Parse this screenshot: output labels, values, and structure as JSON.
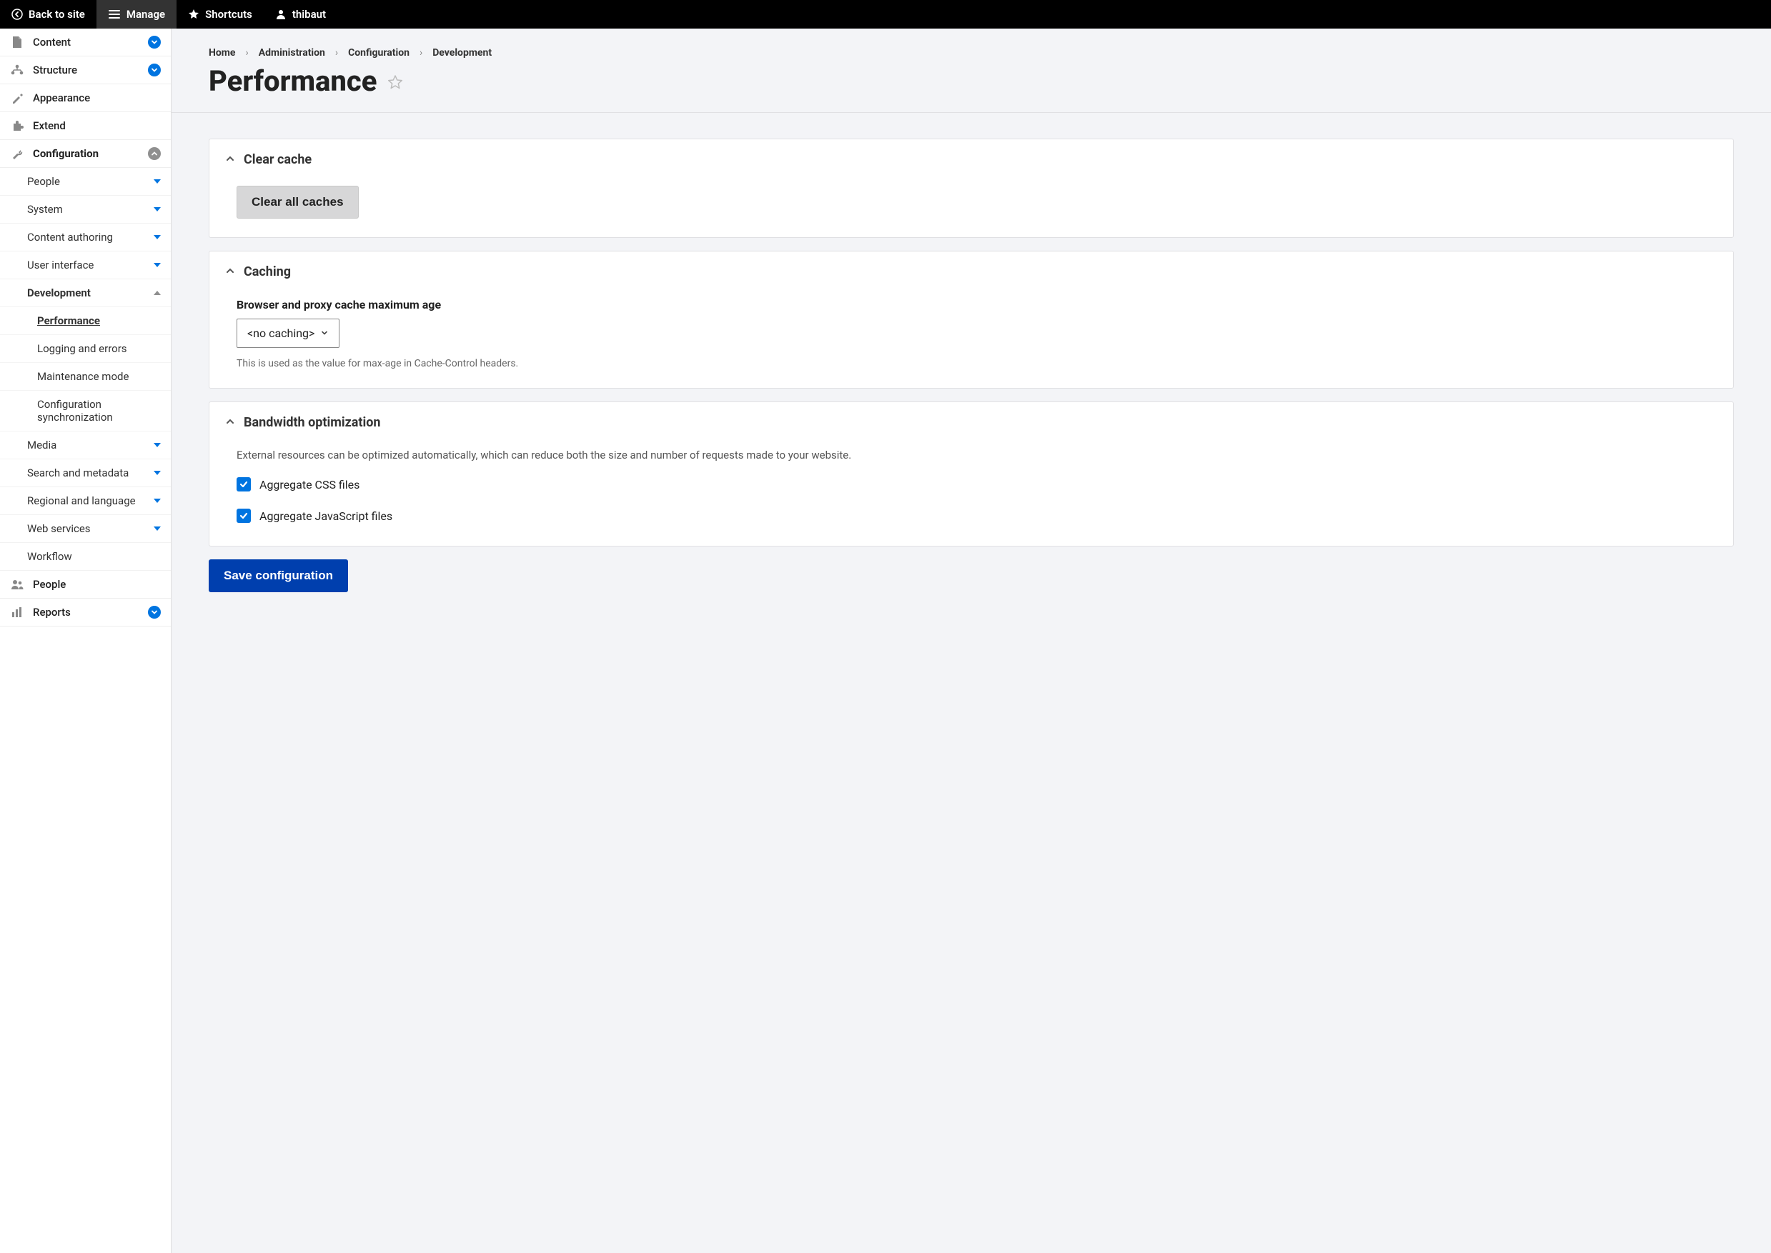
{
  "toolbar": {
    "back": "Back to site",
    "manage": "Manage",
    "shortcuts": "Shortcuts",
    "user": "thibaut"
  },
  "sidebar": {
    "content": "Content",
    "structure": "Structure",
    "appearance": "Appearance",
    "extend": "Extend",
    "configuration": "Configuration",
    "config_items": {
      "people": "People",
      "system": "System",
      "content_authoring": "Content authoring",
      "user_interface": "User interface",
      "development": "Development",
      "dev_items": {
        "performance": "Performance",
        "logging": "Logging and errors",
        "maintenance": "Maintenance mode",
        "config_sync": "Configuration synchronization"
      },
      "media": "Media",
      "search_metadata": "Search and metadata",
      "regional_language": "Regional and language",
      "web_services": "Web services",
      "workflow": "Workflow"
    },
    "people": "People",
    "reports": "Reports"
  },
  "breadcrumb": {
    "home": "Home",
    "administration": "Administration",
    "configuration": "Configuration",
    "development": "Development"
  },
  "page": {
    "title": "Performance"
  },
  "panels": {
    "clear_cache": {
      "title": "Clear cache",
      "button": "Clear all caches"
    },
    "caching": {
      "title": "Caching",
      "field_label": "Browser and proxy cache maximum age",
      "selected": "<no caching>",
      "help": "This is used as the value for max-age in Cache-Control headers."
    },
    "bandwidth": {
      "title": "Bandwidth optimization",
      "description": "External resources can be optimized automatically, which can reduce both the size and number of requests made to your website.",
      "checkbox_css": "Aggregate CSS files",
      "checkbox_js": "Aggregate JavaScript files"
    }
  },
  "actions": {
    "save": "Save configuration"
  }
}
